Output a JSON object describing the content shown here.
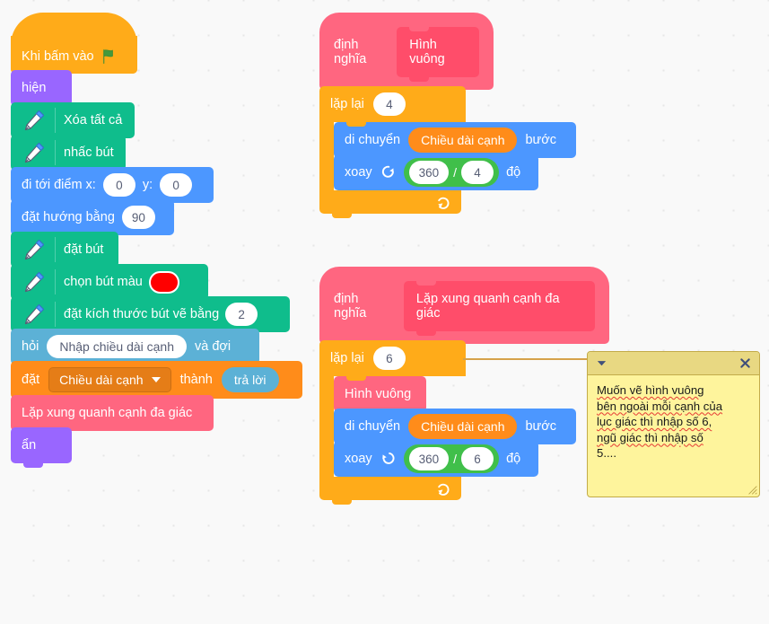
{
  "canvas": {
    "background_color": "#f9f9f9",
    "grid_dot_color": "#e6e6e6"
  },
  "palette": {
    "events": "#FFAB19",
    "looks": "#9966FF",
    "pen": "#0FBD8C",
    "motion": "#4C97FF",
    "sensing": "#5CB1D6",
    "variables": "#FF8C1A",
    "custom_blocks": "#FF6680",
    "control": "#FFAB19",
    "operators": "#40BF4A",
    "pen_color_value": "#FF0000"
  },
  "main_script": {
    "hat": {
      "label": "Khi bấm vào",
      "icon": "green-flag-icon"
    },
    "blocks": [
      {
        "label": "hiện",
        "category": "looks"
      },
      {
        "label": "Xóa tất cả",
        "category": "pen",
        "icon": "pen-icon"
      },
      {
        "label": "nhấc bút",
        "category": "pen",
        "icon": "pen-icon"
      },
      {
        "label_x": "đi tới điểm x:",
        "value_x": "0",
        "label_y": "y:",
        "value_y": "0",
        "category": "motion"
      },
      {
        "label": "đặt hướng bằng",
        "value": "90",
        "category": "motion"
      },
      {
        "label": "đặt bút",
        "category": "pen",
        "icon": "pen-icon"
      },
      {
        "label": "chọn bút màu",
        "swatch": "#FF0000",
        "category": "pen",
        "icon": "pen-icon"
      },
      {
        "label": "đặt kích thước bút vẽ bằng",
        "value": "2",
        "category": "pen",
        "icon": "pen-icon"
      },
      {
        "label_pre": "hỏi",
        "value": "Nhập chiều dài cạnh",
        "label_post": "và đợi",
        "category": "sensing"
      },
      {
        "label_pre": "đặt",
        "variable": "Chiều dài cạnh",
        "label_mid": "thành",
        "reporter": "trả lời",
        "category": "variables"
      },
      {
        "label": "Lặp xung quanh cạnh đa giác",
        "category": "custom"
      },
      {
        "label": "ẩn",
        "category": "looks"
      }
    ]
  },
  "definition_square": {
    "define_label": "định nghĩa",
    "proc_name": "Hình vuông",
    "repeat_label": "lặp lại",
    "repeat_value": "4",
    "move_label": "di chuyển",
    "move_variable": "Chiều dài cạnh",
    "move_unit": "bước",
    "turn_label": "xoay",
    "turn_icon": "turn-clockwise-icon",
    "turn_numerator": "360",
    "turn_operator": "/",
    "turn_denominator": "4",
    "turn_unit": "độ"
  },
  "definition_polygon": {
    "define_label": "định nghĩa",
    "proc_name": "Lặp xung quanh cạnh đa giác",
    "repeat_label": "lặp lại",
    "repeat_value": "6",
    "call_label": "Hình vuông",
    "move_label": "di chuyển",
    "move_variable": "Chiều dài cạnh",
    "move_unit": "bước",
    "turn_label": "xoay",
    "turn_icon": "turn-counterclockwise-icon",
    "turn_numerator": "360",
    "turn_operator": "/",
    "turn_denominator": "6",
    "turn_unit": "độ"
  },
  "comment": {
    "collapse_icon": "chevron-down-icon",
    "close_icon": "close-icon",
    "line1": "Muốn vẽ hình vuông",
    "line2": "bên ngoài mỗi cạnh của",
    "line3": "lục giác thì nhập số 6,",
    "line4": "ngũ giác thì nhập số",
    "line5": "5...."
  }
}
